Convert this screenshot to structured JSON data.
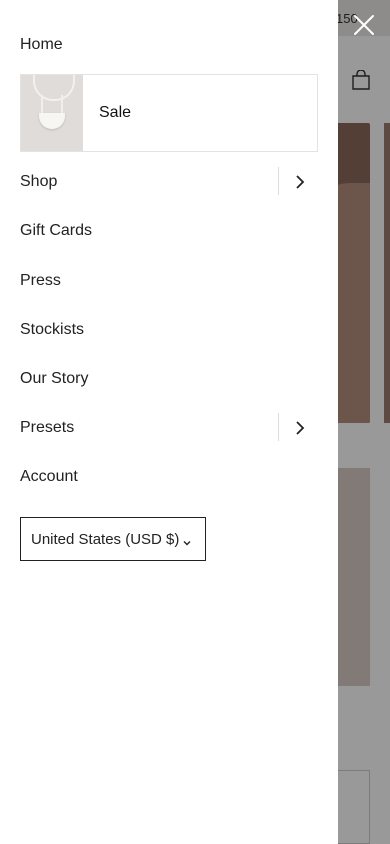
{
  "background": {
    "promo_text": "150"
  },
  "drawer": {
    "items": {
      "home": "Home",
      "sale": "Sale",
      "shop": "Shop",
      "gift_cards": "Gift Cards",
      "press": "Press",
      "stockists": "Stockists",
      "our_story": "Our Story",
      "presets": "Presets",
      "account": "Account"
    },
    "currency": "United States (USD $)"
  },
  "icons": {
    "close": "close-icon",
    "shop_arrow": "chevron-right-icon",
    "presets_arrow": "chevron-right-icon",
    "currency_arrow": "chevron-down-icon",
    "bag": "bag-icon"
  },
  "colors": {
    "overlay": "#000000",
    "drawer_bg": "#ffffff",
    "text": "#222222"
  }
}
